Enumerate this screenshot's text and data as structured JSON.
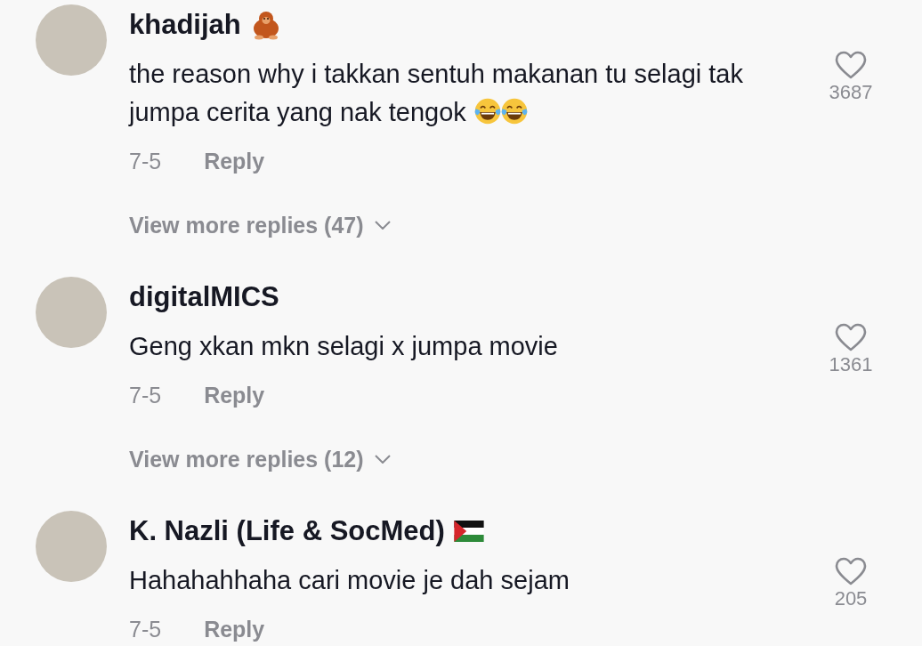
{
  "comments": [
    {
      "username": "khadijah",
      "name_icons": [
        {
          "kind": "orangutan"
        }
      ],
      "text": "the reason why i takkan sentuh makanan tu selagi tak jumpa cerita yang nak tengok",
      "text_icons": [
        {
          "kind": "laughing"
        },
        {
          "kind": "laughing"
        }
      ],
      "likes": "3687",
      "date": "7-5",
      "reply": "Reply",
      "view_more": "View more replies (47)"
    },
    {
      "username": "digitalMICS",
      "text": "Geng xkan mkn selagi x jumpa movie",
      "likes": "1361",
      "date": "7-5",
      "reply": "Reply",
      "view_more": "View more replies (12)"
    },
    {
      "username": "K. Nazli (Life & SocMed)",
      "name_icons": [
        {
          "kind": "flag"
        }
      ],
      "text": "Hahahahhaha cari movie je dah sejam",
      "likes": "205",
      "date": "7-5",
      "reply": "Reply"
    }
  ]
}
